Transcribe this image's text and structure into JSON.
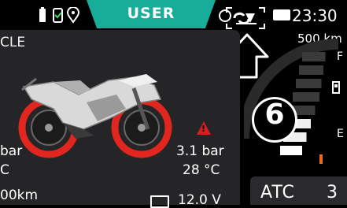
{
  "statusbar": {
    "mode": "USER",
    "time": "23:30"
  },
  "left_card": {
    "title": "CLE",
    "tyre_pressure": "3.1 bar",
    "tyre_temp": "28 °C",
    "stub_line1": "bar",
    "stub_line2": "C",
    "bottom_left": "00km",
    "battery_voltage": "12.0 V"
  },
  "right_panel": {
    "range": "500 km",
    "fuel_full": "F",
    "fuel_empty": "E",
    "gear": "6",
    "atc_label": "ATC",
    "atc_value": "3"
  },
  "colors": {
    "accent": "#18ad99",
    "warning": "#d42020",
    "tyre_red": "#e0261f"
  },
  "fuel": {
    "segments": 8,
    "filled": 3
  }
}
